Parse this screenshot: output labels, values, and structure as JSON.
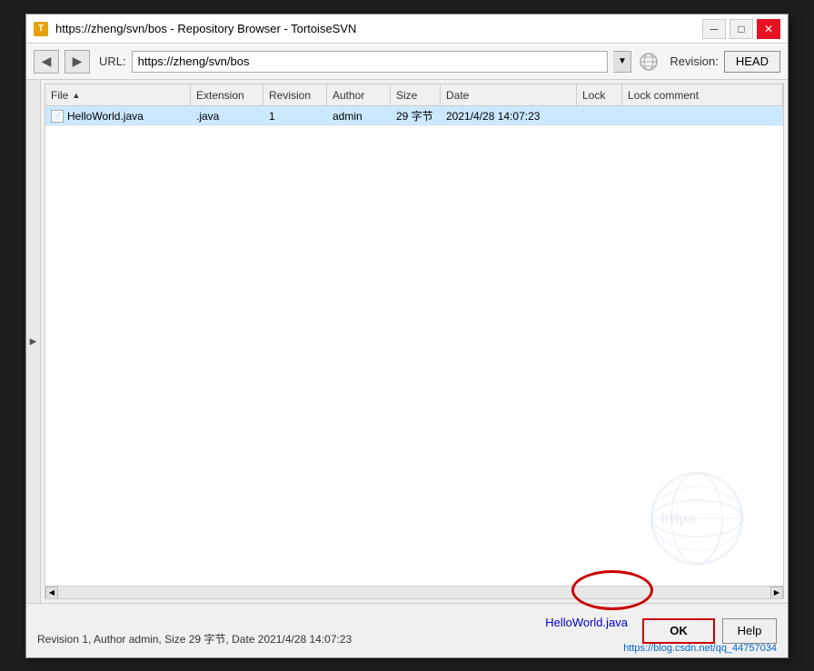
{
  "window": {
    "title": "https://zheng/svn/bos - Repository Browser - TortoiseSVN",
    "icon_label": "T"
  },
  "toolbar": {
    "back_label": "◀",
    "forward_label": "▶",
    "url_label": "URL:",
    "url_value": "https://zheng/svn/bos",
    "revision_label": "Revision:",
    "revision_value": "HEAD",
    "dropdown_arrow": "▼"
  },
  "columns": {
    "file": {
      "label": "File",
      "sort_arrow": "▲"
    },
    "extension": {
      "label": "Extension"
    },
    "revision": {
      "label": "Revision"
    },
    "author": {
      "label": "Author"
    },
    "size": {
      "label": "Size"
    },
    "date": {
      "label": "Date"
    },
    "lock": {
      "label": "Lock"
    },
    "lock_comment": {
      "label": "Lock comment"
    }
  },
  "files": [
    {
      "name": "HelloWorld.java",
      "extension": ".java",
      "revision": "1",
      "author": "admin",
      "size": "29 字节",
      "date": "2021/4/28 14:07:23",
      "lock": "",
      "lock_comment": ""
    }
  ],
  "status": {
    "filename": "HelloWorld.java",
    "details": "Revision 1, Author admin, Size 29 字节, Date 2021/4/28 14:07:23"
  },
  "buttons": {
    "ok": "OK",
    "help": "Help"
  },
  "blog_url": "https://blog.csdn.net/qq_44757034",
  "watermark": {
    "text": "https"
  }
}
